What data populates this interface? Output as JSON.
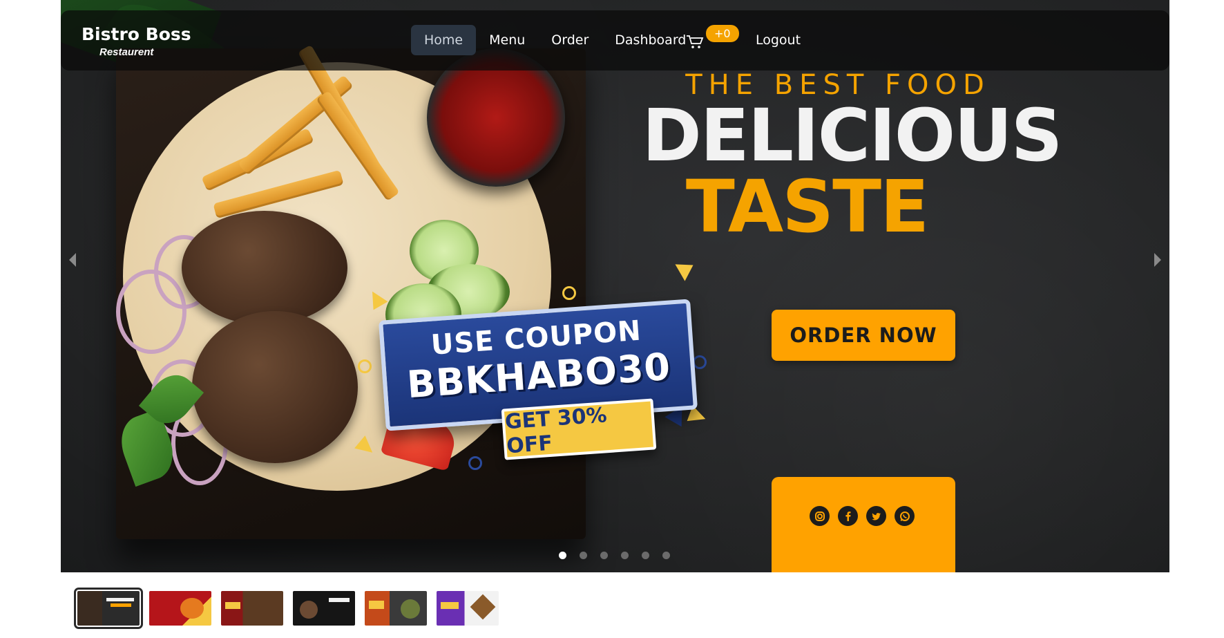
{
  "navbar": {
    "brand_title": "Bistro Boss",
    "brand_subtitle": "Restaurent",
    "links": [
      {
        "label": "Home",
        "active": true
      },
      {
        "label": "Menu",
        "active": false
      },
      {
        "label": "Order",
        "active": false
      },
      {
        "label": "Dashboard",
        "active": false
      }
    ],
    "cart_icon": "cart-icon",
    "cart_badge": "+0",
    "logout_label": "Logout"
  },
  "slide": {
    "kicker": "THE BEST FOOD",
    "headline_line1": "DELICIOUS",
    "headline_line2": "TASTE",
    "order_button": "ORDER NOW",
    "coupon_line1": "USE COUPON",
    "coupon_code": "BBKHABO30",
    "coupon_offer": "GET 30% OFF",
    "social_icons": [
      "instagram-icon",
      "facebook-icon",
      "twitter-icon",
      "whatsapp-icon"
    ]
  },
  "carousel": {
    "prev_icon": "chevron-left-icon",
    "next_icon": "chevron-right-icon",
    "dot_count": 6,
    "active_dot": 0
  },
  "thumbnails": {
    "count": 6,
    "active_index": 0,
    "colors": [
      "#2b2b2b",
      "#b5151a",
      "#8a1616",
      "#151515",
      "#c44a1a",
      "#6a2fb3"
    ],
    "accent": "#ffa200"
  }
}
